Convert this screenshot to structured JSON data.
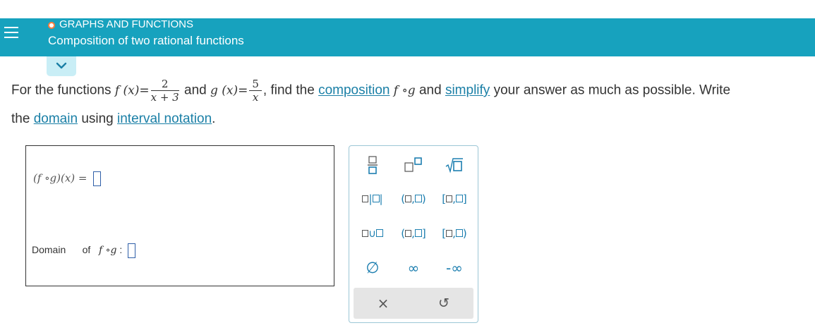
{
  "header": {
    "topic": "GRAPHS AND FUNCTIONS",
    "title": "Composition of two rational functions"
  },
  "question": {
    "intro": "For the functions",
    "f_label": "f (x)=",
    "f_num": "2",
    "f_den": "x + 3",
    "and1": "and",
    "g_label": "g (x)=",
    "g_num": "5",
    "g_den": "x",
    "comma": ",",
    "find": "find the",
    "composition_link": "composition",
    "fog": "f ∘g",
    "and2": "and",
    "simplify_link": "simplify",
    "rest1": "your answer as much as possible. Write",
    "the": "the",
    "domain_link": "domain",
    "using": "using",
    "interval_link": "interval notation",
    "period": "."
  },
  "answer": {
    "expr_label": "(f ∘g)(x) =",
    "domain_label": "Domain",
    "of_label": "of",
    "domain_fog": "f ∘g",
    "colon": ":"
  },
  "palette": {
    "row3": [
      "∅",
      "∞",
      "-∞"
    ],
    "row4": [
      "×",
      "↺"
    ]
  },
  "colors": {
    "header_bg": "#17a2be",
    "link": "#1a7fa6",
    "palette_icon": "#1d7fb0",
    "topic_dot": "#ff7c3a"
  }
}
